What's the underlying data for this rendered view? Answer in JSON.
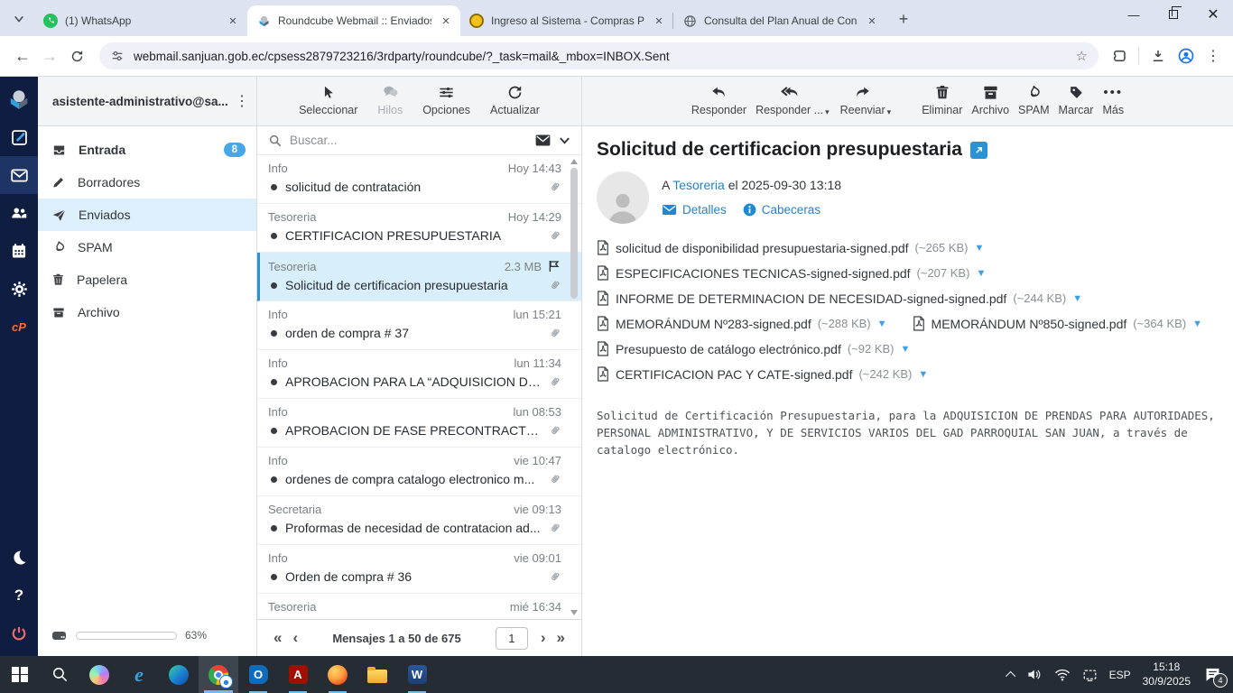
{
  "browser": {
    "tabs": [
      {
        "title": "(1) WhatsApp"
      },
      {
        "title": "Roundcube Webmail :: Enviados"
      },
      {
        "title": "Ingreso al Sistema - Compras P"
      },
      {
        "title": "Consulta del Plan Anual de Con"
      }
    ],
    "url": "webmail.sanjuan.gob.ec/cpsess2879723216/3rdparty/roundcube/?_task=mail&_mbox=INBOX.Sent"
  },
  "sidebar": {
    "account": "asistente-administrativo@sa...",
    "folders": [
      {
        "label": "Entrada",
        "badge": "8"
      },
      {
        "label": "Borradores"
      },
      {
        "label": "Enviados"
      },
      {
        "label": "SPAM"
      },
      {
        "label": "Papelera"
      },
      {
        "label": "Archivo"
      }
    ],
    "quota": {
      "percent": "63%"
    }
  },
  "list": {
    "toolbar": {
      "select": "Seleccionar",
      "threads": "Hilos",
      "options": "Opciones",
      "refresh": "Actualizar"
    },
    "search_placeholder": "Buscar...",
    "messages": [
      {
        "sender": "Info",
        "meta": "Hoy 14:43",
        "subject": "solicitud de contratación"
      },
      {
        "sender": "Tesoreria",
        "meta": "Hoy 14:29",
        "subject": "CERTIFICACION PRESUPUESTARIA"
      },
      {
        "sender": "Tesoreria",
        "meta": "2.3 MB",
        "subject": "Solicitud de certificacion presupuestaria"
      },
      {
        "sender": "Info",
        "meta": "lun 15:21",
        "subject": "orden de compra # 37"
      },
      {
        "sender": "Info",
        "meta": "lun 11:34",
        "subject": "APROBACION PARA LA “ADQUISICION DE B..."
      },
      {
        "sender": "Info",
        "meta": "lun 08:53",
        "subject": "APROBACION DE FASE PRECONTRACTUAL ..."
      },
      {
        "sender": "Info",
        "meta": "vie 10:47",
        "subject": "ordenes de compra catalogo electronico m..."
      },
      {
        "sender": "Secretaria",
        "meta": "vie 09:13",
        "subject": "Proformas de necesidad de contratacion ad..."
      },
      {
        "sender": "Info",
        "meta": "vie 09:01",
        "subject": "Orden de compra # 36"
      },
      {
        "sender": "Tesoreria",
        "meta": "mié 16:34",
        "subject": ""
      }
    ],
    "footer": {
      "range": "Mensajes 1 a 50 de 675",
      "page": "1"
    }
  },
  "mail": {
    "toolbar": {
      "reply": "Responder",
      "reply_all": "Responder ...",
      "forward": "Reenviar",
      "delete": "Eliminar",
      "archive": "Archivo",
      "spam": "SPAM",
      "mark": "Marcar",
      "more": "Más"
    },
    "subject": "Solicitud de certificacion presupuestaria",
    "to_prefix": "A",
    "to_name": "Tesoreria",
    "date_line": "el 2025-09-30 13:18",
    "details_label": "Detalles",
    "headers_label": "Cabeceras",
    "attachments": [
      {
        "name": "solicitud de disponibilidad presupuestaria-signed.pdf",
        "size": "(~265 KB)"
      },
      {
        "name": "ESPECIFICACIONES TECNICAS-signed-signed.pdf",
        "size": "(~207 KB)"
      },
      {
        "name": "INFORME DE DETERMINACION DE NECESIDAD-signed-signed.pdf",
        "size": "(~244 KB)"
      },
      {
        "name": "MEMORÁNDUM Nº283-signed.pdf",
        "size": "(~288 KB)"
      },
      {
        "name": "MEMORÁNDUM Nº850-signed.pdf",
        "size": "(~364 KB)"
      },
      {
        "name": "Presupuesto de catálogo electrónico.pdf",
        "size": "(~92 KB)"
      },
      {
        "name": "CERTIFICACION PAC Y CATE-signed.pdf",
        "size": "(~242 KB)"
      }
    ],
    "body_text": "Solicitud de Certificación Presupuestaria, para la ADQUISICION DE PRENDAS PARA AUTORIDADES, PERSONAL ADMINISTRATIVO, Y DE SERVICIOS VARIOS DEL GAD PARROQUIAL SAN JUAN, a través de catalogo electrónico."
  },
  "taskbar": {
    "language": "ESP",
    "time": "15:18",
    "date": "30/9/2025",
    "notification_count": "4"
  },
  "colors": {
    "accent_blue": "#2a93d5",
    "rail_navy": "#0e1d40",
    "selection_blue": "#d9eefb",
    "badge_blue": "#46a8ea",
    "quota_fill": "#79bcec"
  }
}
